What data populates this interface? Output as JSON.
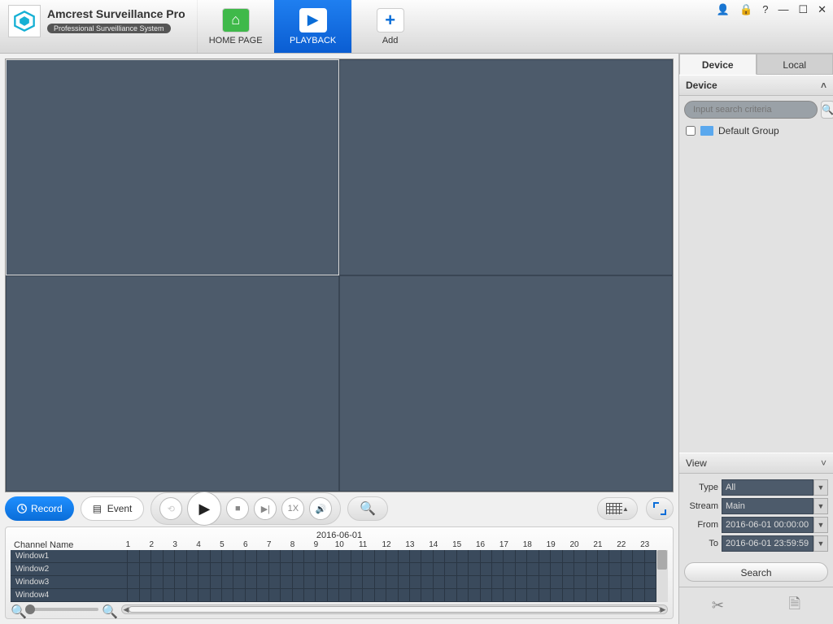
{
  "brand": {
    "title": "Amcrest Surveillance Pro",
    "subtitle": "Professional Surveilliance System"
  },
  "tabs": {
    "home": "HOME PAGE",
    "playback": "PLAYBACK",
    "add": "Add"
  },
  "controls": {
    "record": "Record",
    "event": "Event",
    "speed": "1X"
  },
  "timeline": {
    "date": "2016-06-01",
    "channel_header": "Channel Name",
    "hours": [
      "1",
      "2",
      "3",
      "4",
      "5",
      "6",
      "7",
      "8",
      "9",
      "10",
      "11",
      "12",
      "13",
      "14",
      "15",
      "16",
      "17",
      "18",
      "19",
      "20",
      "21",
      "22",
      "23"
    ],
    "channels": [
      "Window1",
      "Window2",
      "Window3",
      "Window4"
    ]
  },
  "right": {
    "tab_device": "Device",
    "tab_local": "Local",
    "section_device": "Device",
    "search_placeholder": "Input search criteria",
    "default_group": "Default Group",
    "section_view": "View",
    "type_label": "Type",
    "type_value": "All",
    "stream_label": "Stream",
    "stream_value": "Main",
    "from_label": "From",
    "from_value": "2016-06-01 00:00:00",
    "to_label": "To",
    "to_value": "2016-06-01 23:59:59",
    "search_button": "Search"
  }
}
